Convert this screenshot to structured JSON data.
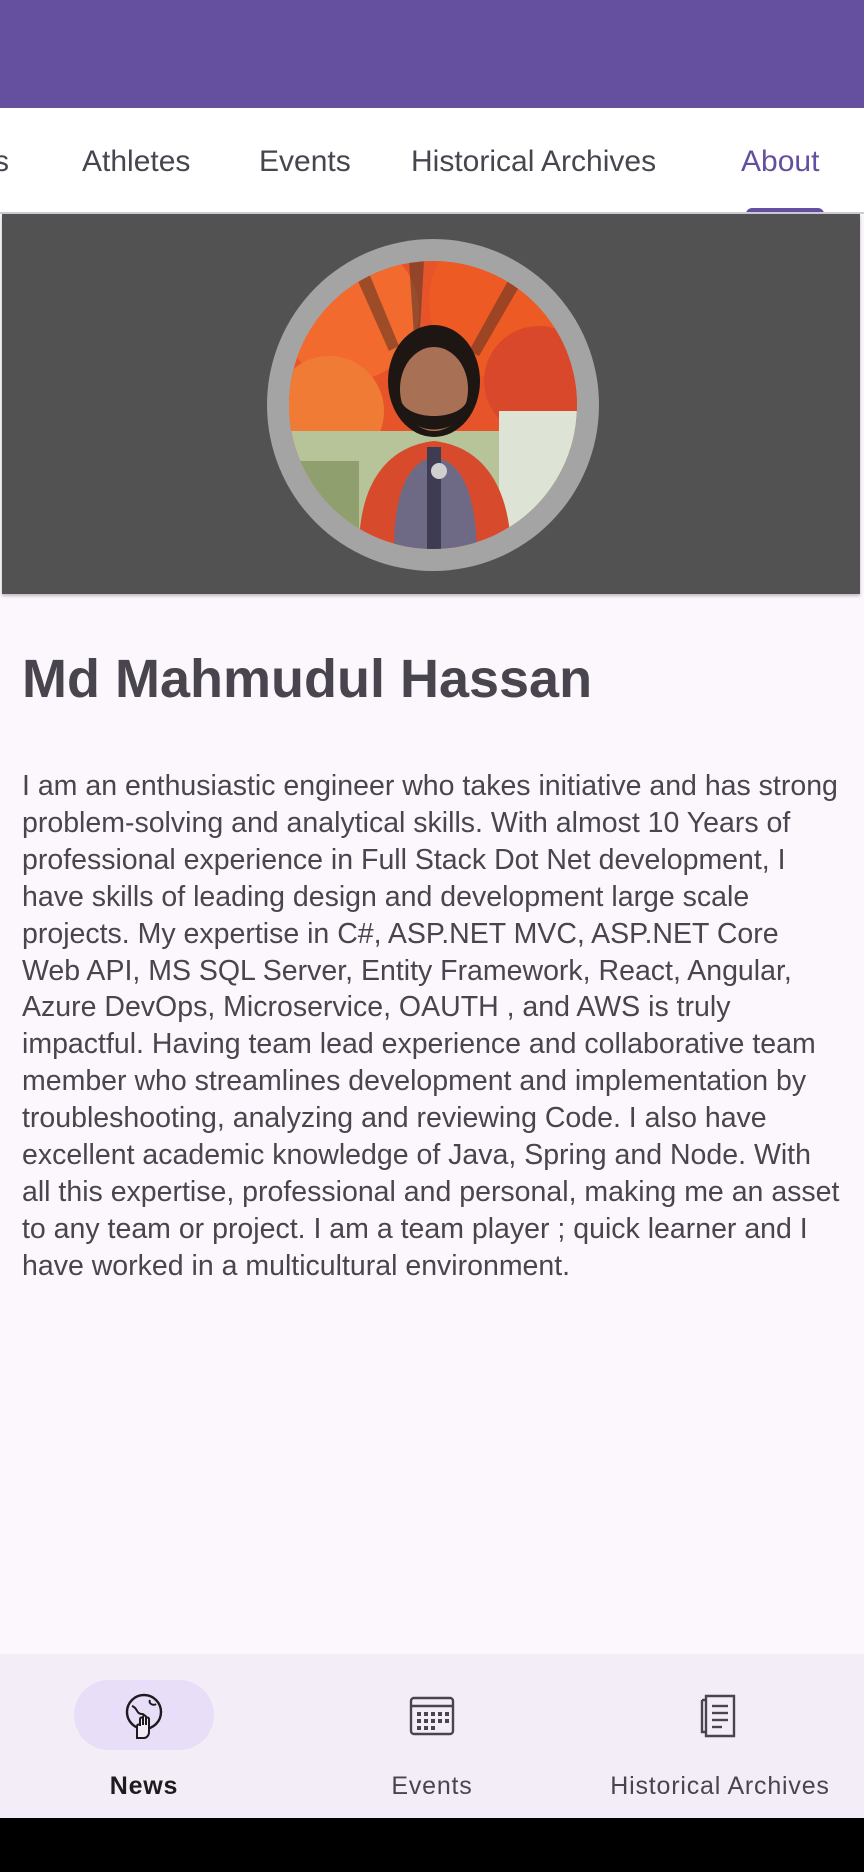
{
  "tabs": [
    {
      "label": "s"
    },
    {
      "label": "Athletes"
    },
    {
      "label": "Events"
    },
    {
      "label": "Historical Archives"
    },
    {
      "label": "About",
      "selected": true
    }
  ],
  "profile": {
    "name": "Md Mahmudul Hassan",
    "bio": "I am an enthusiastic engineer who takes initiative and has strong problem-solving and analytical skills. With almost 10 Years of professional experience in Full Stack Dot Net development, I have skills of leading design and development large scale projects. My expertise in C#, ASP.NET MVC, ASP.NET Core Web API, MS SQL Server, Entity Framework, React, Angular, Azure DevOps, Microservice, OAUTH , and AWS is truly impactful. Having team lead experience and collaborative team member who streamlines development and implementation by troubleshooting, analyzing and reviewing Code. I also have excellent academic knowledge of Java, Spring and Node. With all this expertise, professional and personal, making me an asset to any team or project. I am a team player ; quick learner and I have worked in a multicultural environment."
  },
  "bottom_nav": [
    {
      "label": "News",
      "icon": "globe-hand-icon",
      "selected": true
    },
    {
      "label": "Events",
      "icon": "calendar-icon"
    },
    {
      "label": "Historical Archives",
      "icon": "document-icon"
    }
  ],
  "colors": {
    "primary": "#6550A0",
    "header_panel": "#525252",
    "text": "#49454F",
    "nav_background": "#F3EDF7",
    "nav_active_pill": "#E8DEF8"
  }
}
